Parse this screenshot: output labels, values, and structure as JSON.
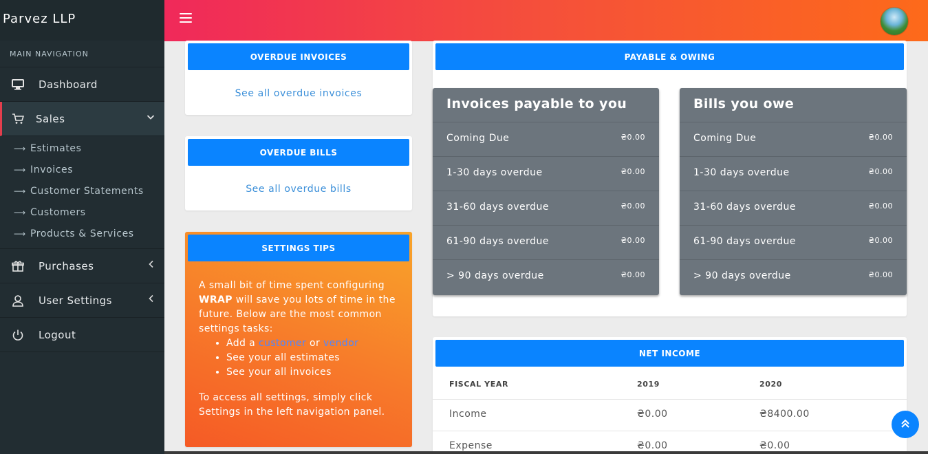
{
  "app": {
    "brand": "Parvez LLP"
  },
  "sidebar": {
    "header": "MAIN NAVIGATION",
    "dashboard": "Dashboard",
    "sales": "Sales",
    "sales_items": [
      "Estimates",
      "Invoices",
      "Customer Statements",
      "Customers",
      "Products & Services"
    ],
    "purchases": "Purchases",
    "user_settings": "User Settings",
    "logout": "Logout"
  },
  "overdue_invoices": {
    "title": "OVERDUE INVOICES",
    "link": "See all overdue invoices"
  },
  "overdue_bills": {
    "title": "OVERDUE BILLS",
    "link": "See all overdue bills"
  },
  "settings_tips": {
    "title": "SETTINGS TIPS",
    "intro_1": "A small bit of time spent configuring ",
    "intro_bold": "WRAP",
    "intro_2": " will save you lots of time in the future. Below are the most common settings tasks:",
    "bullet_1a": "Add a ",
    "bullet_1_customer": "customer",
    "bullet_1b": " or ",
    "bullet_1_vendor": "vendor",
    "bullet_2": "See your all estimates",
    "bullet_3": "See your all invoices",
    "outro": "To access all settings, simply click Settings in the left navigation panel."
  },
  "payable": {
    "title": "PAYABLE & OWING",
    "invoices_title": "Invoices payable to you",
    "bills_title": "Bills you owe",
    "rows": [
      {
        "label": "Coming Due",
        "inv": "₴0.00",
        "bill": "₴0.00"
      },
      {
        "label": "1-30 days overdue",
        "inv": "₴0.00",
        "bill": "₴0.00"
      },
      {
        "label": "31-60 days overdue",
        "inv": "₴0.00",
        "bill": "₴0.00"
      },
      {
        "label": "61-90 days overdue",
        "inv": "₴0.00",
        "bill": "₴0.00"
      },
      {
        "label": "> 90 days overdue",
        "inv": "₴0.00",
        "bill": "₴0.00"
      }
    ]
  },
  "net_income": {
    "title": "NET INCOME",
    "headers": [
      "FISCAL YEAR",
      "2019",
      "2020"
    ],
    "rows": [
      [
        "Income",
        "₴0.00",
        "₴8400.00"
      ],
      [
        "Expense",
        "₴0.00",
        "₴0.00"
      ]
    ]
  },
  "icons": {
    "menu": "menu-icon",
    "scroll_top": "double-chevron-up-icon"
  }
}
